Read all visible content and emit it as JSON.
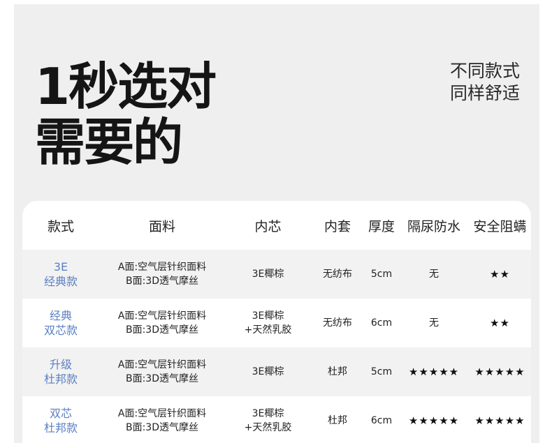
{
  "headline": {
    "line1": "1秒选对",
    "line2": "需要的"
  },
  "tagline": {
    "line1": "不同款式",
    "line2": "同样舒适"
  },
  "table": {
    "headers": [
      "款式",
      "面料",
      "内芯",
      "内套",
      "厚度",
      "隔尿防水",
      "安全阻螨"
    ],
    "rows": [
      {
        "model": [
          "3E",
          "经典款"
        ],
        "fabric": [
          "A面:空气层针织面料",
          "B面:3D透气摩丝"
        ],
        "core": [
          "3E椰棕"
        ],
        "cover": "无纺布",
        "thickness": "5cm",
        "waterproof": "无",
        "mite": "★★"
      },
      {
        "model": [
          "经典",
          "双芯款"
        ],
        "fabric": [
          "A面:空气层针织面料",
          "B面:3D透气摩丝"
        ],
        "core": [
          "3E椰棕",
          "+天然乳胶"
        ],
        "cover": "无纺布",
        "thickness": "6cm",
        "waterproof": "无",
        "mite": "★★"
      },
      {
        "model": [
          "升级",
          "杜邦款"
        ],
        "fabric": [
          "A面:空气层针织面料",
          "B面:3D透气摩丝"
        ],
        "core": [
          "3E椰棕"
        ],
        "cover": "杜邦",
        "thickness": "5cm",
        "waterproof": "★★★★★",
        "mite": "★★★★★"
      },
      {
        "model": [
          "双芯",
          "杜邦款"
        ],
        "fabric": [
          "A面:空气层针织面料",
          "B面:3D透气摩丝"
        ],
        "core": [
          "3E椰棕",
          "+天然乳胶"
        ],
        "cover": "杜邦",
        "thickness": "6cm",
        "waterproof": "★★★★★",
        "mite": "★★★★★"
      }
    ]
  },
  "colors": {
    "model_text": "#5a7fc4",
    "panel_bg": "#efefef",
    "row_shade": "#f2f2f2"
  }
}
